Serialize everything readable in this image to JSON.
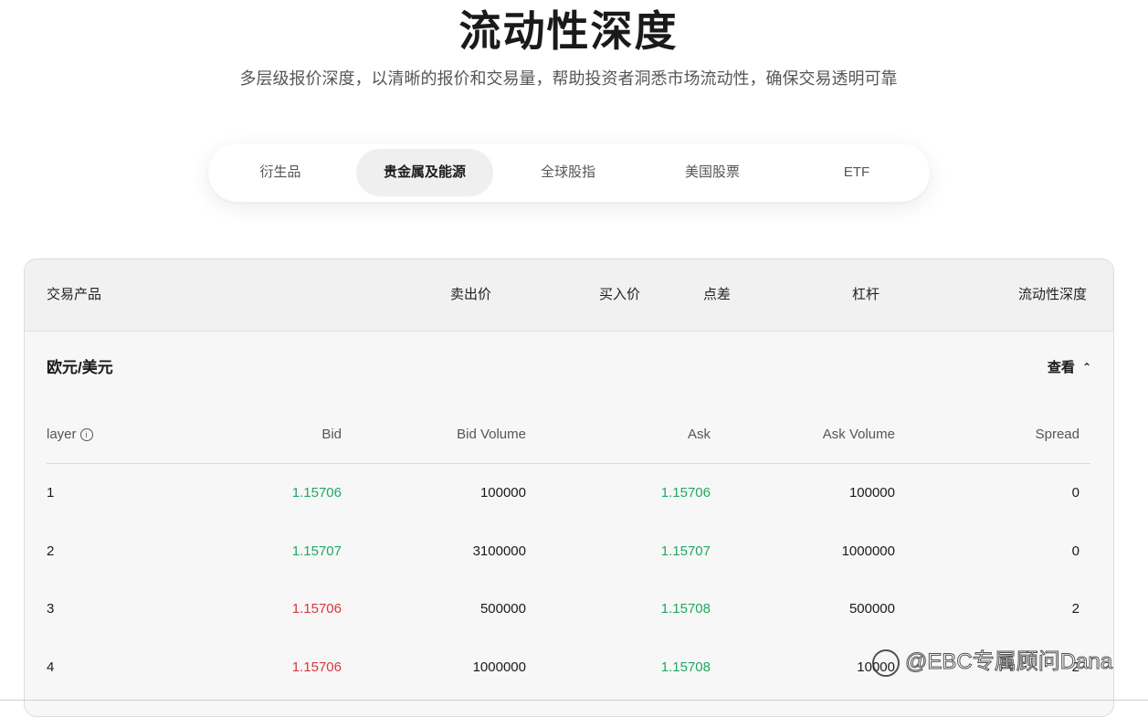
{
  "header": {
    "title": "流动性深度",
    "subtitle": "多层级报价深度，以清晰的报价和交易量，帮助投资者洞悉市场流动性，确保交易透明可靠"
  },
  "tabs": [
    {
      "label": "衍生品",
      "active": false
    },
    {
      "label": "贵金属及能源",
      "active": true
    },
    {
      "label": "全球股指",
      "active": false
    },
    {
      "label": "美国股票",
      "active": false
    },
    {
      "label": "ETF",
      "active": false
    }
  ],
  "table": {
    "columns": [
      "交易产品",
      "卖出价",
      "买入价",
      "点差",
      "杠杆",
      "流动性深度"
    ],
    "product": {
      "name": "欧元/美元",
      "view_label": "查看",
      "depth_columns": [
        "layer",
        "Bid",
        "Bid Volume",
        "Ask",
        "Ask Volume",
        "Spread"
      ],
      "rows": [
        {
          "layer": "1",
          "bid": "1.15706",
          "bid_color": "green",
          "bid_volume": "100000",
          "ask": "1.15706",
          "ask_color": "green",
          "ask_volume": "100000",
          "spread": "0"
        },
        {
          "layer": "2",
          "bid": "1.15707",
          "bid_color": "green",
          "bid_volume": "3100000",
          "ask": "1.15707",
          "ask_color": "green",
          "ask_volume": "1000000",
          "spread": "0"
        },
        {
          "layer": "3",
          "bid": "1.15706",
          "bid_color": "red",
          "bid_volume": "500000",
          "ask": "1.15708",
          "ask_color": "green",
          "ask_volume": "500000",
          "spread": "2"
        },
        {
          "layer": "4",
          "bid": "1.15706",
          "bid_color": "red",
          "bid_volume": "1000000",
          "ask": "1.15708",
          "ask_color": "green",
          "ask_volume": "10000",
          "spread": "2"
        }
      ]
    }
  },
  "watermark": "@EBC专属顾问Dana",
  "colors": {
    "up": "#1fa864",
    "down": "#d9363e"
  }
}
